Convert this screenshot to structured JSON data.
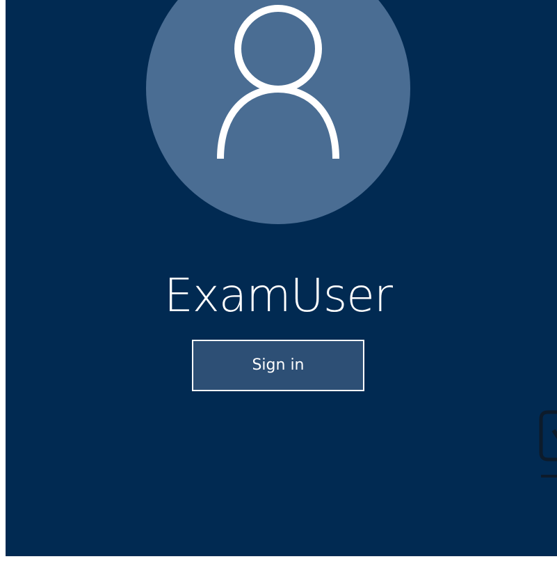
{
  "login": {
    "username": "ExamUser",
    "sign_in_label": "Sign in"
  },
  "icons": {
    "avatar": "user-silhouette-icon",
    "edge": "partial-device-icon"
  },
  "colors": {
    "background": "#012a52",
    "avatar_circle": "#4a6d93",
    "button_fill": "#2d4f75",
    "text": "#ffffff"
  }
}
